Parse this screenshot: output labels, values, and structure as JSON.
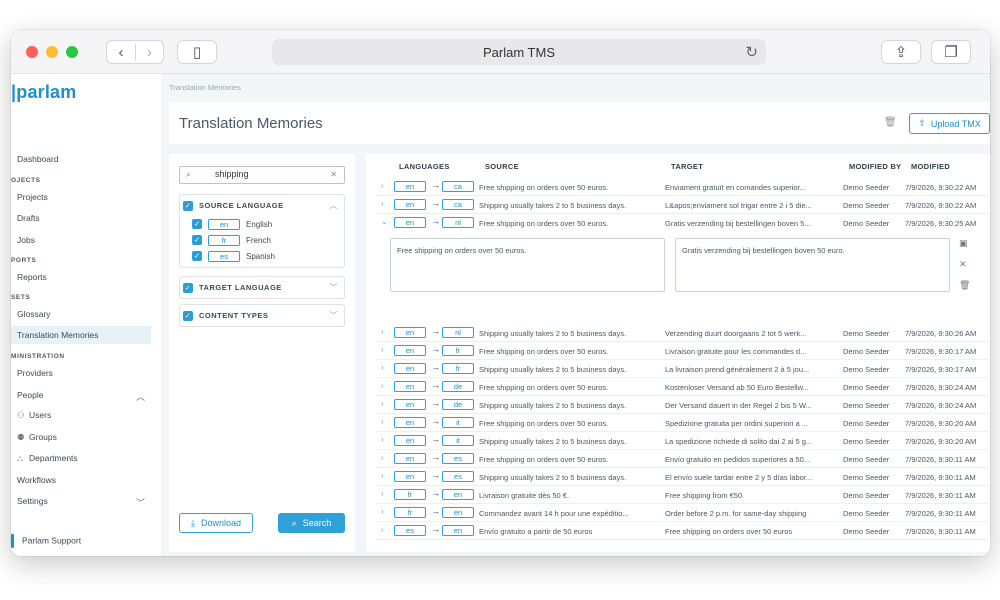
{
  "browser": {
    "url_title": "Parlam TMS"
  },
  "app": {
    "logo": "parlam",
    "support": "Parlam Support"
  },
  "sidebar": {
    "sections": [
      {
        "label": "OJECTS"
      },
      {
        "label": "PORTS"
      },
      {
        "label": "SETS"
      },
      {
        "label": "MINISTRATION"
      }
    ],
    "items": {
      "dashboard": "Dashboard",
      "projects": "Projects",
      "drafts": "Drafts",
      "jobs": "Jobs",
      "reports": "Reports",
      "glossary": "Glossary",
      "translation_memories": "Translation Memories",
      "providers": "Providers",
      "people": "People",
      "users": "Users",
      "groups": "Groups",
      "departments": "Departments",
      "workflows": "Workflows",
      "settings": "Settings"
    }
  },
  "breadcrumb": "Translation Memories",
  "page": {
    "title": "Translation Memories",
    "upload_label": "Upload TMX"
  },
  "filter": {
    "search_value": "shipping",
    "source_language": {
      "title": "SOURCE LANGUAGE",
      "options": [
        {
          "code": "en",
          "name": "English"
        },
        {
          "code": "fr",
          "name": "French"
        },
        {
          "code": "es",
          "name": "Spanish"
        }
      ]
    },
    "target_language_title": "TARGET LANGUAGE",
    "content_types_title": "CONTENT TYPES",
    "download_label": "Download",
    "search_label": "Search"
  },
  "table": {
    "headers": {
      "languages": "LANGUAGES",
      "source": "SOURCE",
      "target": "TARGET",
      "modified_by": "MODIFIED BY",
      "modified": "MODIFIED"
    },
    "rows": [
      {
        "from": "en",
        "to": "ca",
        "source": "Free shipping on orders over 50 euros.",
        "target": "Enviament gratuït en comandes superior...",
        "by": "Demo Seeder",
        "date": "7/9/2026, 9:30:22 AM"
      },
      {
        "from": "en",
        "to": "ca",
        "source": "Shipping usually takes 2 to 5 business days.",
        "target": "L&apos;enviament sol trigar entre 2 i 5 die...",
        "by": "Demo Seeder",
        "date": "7/9/2026, 9:30:22 AM"
      },
      {
        "from": "en",
        "to": "nl",
        "source": "Free shipping on orders over 50 euros.",
        "target": "Gratis verzending bij bestellingen boven 5...",
        "by": "Demo Seeder",
        "date": "7/9/2026, 9:30:25 AM"
      },
      {
        "from": "en",
        "to": "nl",
        "source": "Shipping usually takes 2 to 5 business days.",
        "target": "Verzending duurt doorgaans 2 tot 5 werk...",
        "by": "Demo Seeder",
        "date": "7/9/2026, 9:30:26 AM"
      },
      {
        "from": "en",
        "to": "fr",
        "source": "Free shipping on orders over 50 euros.",
        "target": "Livraison gratuite pour les commandes d...",
        "by": "Demo Seeder",
        "date": "7/9/2026, 9:30:17 AM"
      },
      {
        "from": "en",
        "to": "fr",
        "source": "Shipping usually takes 2 to 5 business days.",
        "target": "La livraison prend généralement 2 à 5 jou...",
        "by": "Demo Seeder",
        "date": "7/9/2026, 9:30:17 AM"
      },
      {
        "from": "en",
        "to": "de",
        "source": "Free shipping on orders over 50 euros.",
        "target": "Kostenloser Versand ab 50 Euro Bestellw...",
        "by": "Demo Seeder",
        "date": "7/9/2026, 9:30:24 AM"
      },
      {
        "from": "en",
        "to": "de",
        "source": "Shipping usually takes 2 to 5 business days.",
        "target": "Der Versand dauert in der Regel 2 bis 5 W...",
        "by": "Demo Seeder",
        "date": "7/9/2026, 9:30:24 AM"
      },
      {
        "from": "en",
        "to": "it",
        "source": "Free shipping on orders over 50 euros.",
        "target": "Spedizione gratuita per ordini superiori a ...",
        "by": "Demo Seeder",
        "date": "7/9/2026, 9:30:20 AM"
      },
      {
        "from": "en",
        "to": "it",
        "source": "Shipping usually takes 2 to 5 business days.",
        "target": "La spedizione richiede di solito dai 2 ai 5 g...",
        "by": "Demo Seeder",
        "date": "7/9/2026, 9:30:20 AM"
      },
      {
        "from": "en",
        "to": "es",
        "source": "Free shipping on orders over 50 euros.",
        "target": "Envío gratuito en pedidos superiores a 50...",
        "by": "Demo Seeder",
        "date": "7/9/2026, 9:30:11 AM"
      },
      {
        "from": "en",
        "to": "es",
        "source": "Shipping usually takes 2 to 5 business days.",
        "target": "El envío suele tardar entre 2 y 5 días labor...",
        "by": "Demo Seeder",
        "date": "7/9/2026, 9:30:11 AM"
      },
      {
        "from": "fr",
        "to": "en",
        "source": "Livraison gratuite dès 50 €.",
        "target": "Free shipping from €50",
        "by": "Demo Seeder",
        "date": "7/9/2026, 9:30:11 AM"
      },
      {
        "from": "fr",
        "to": "en",
        "source": "Commandez avant 14 h pour une expéditio...",
        "target": "Order before 2 p.m. for same-day shipping",
        "by": "Demo Seeder",
        "date": "7/9/2026, 9:30:11 AM"
      },
      {
        "from": "es",
        "to": "en",
        "source": "Envío gratuito a partir de 50 euros",
        "target": "Free shipping on orders over 50 euros",
        "by": "Demo Seeder",
        "date": "7/9/2026, 9:30:11 AM"
      }
    ],
    "expanded": {
      "source_text": "Free shipping on orders over 50 euros.",
      "target_text": "Gratis verzending bij bestellingen boven 50 euro."
    }
  },
  "colors": {
    "accent": "#2fa0d8",
    "brand": "#1f8fc9",
    "active_bg": "#e7f1f8"
  }
}
